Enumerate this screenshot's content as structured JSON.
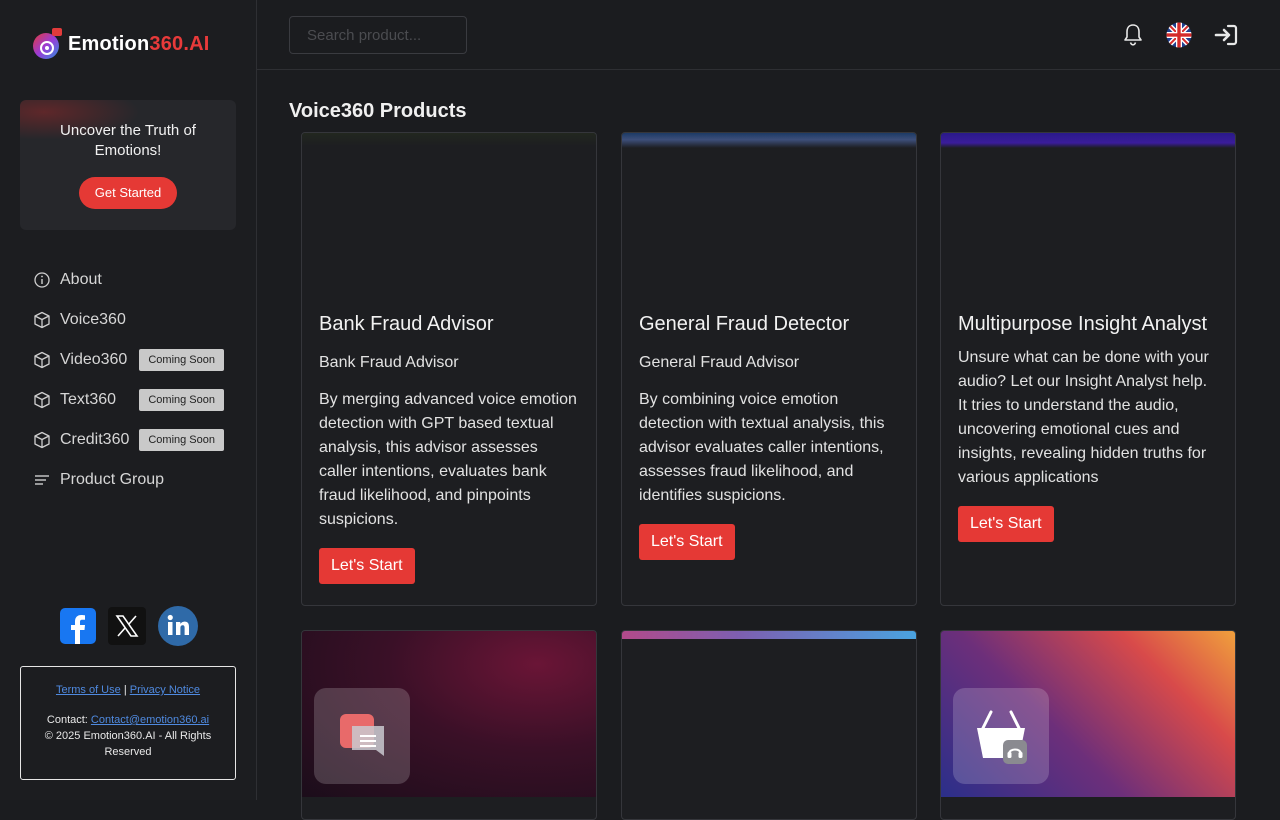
{
  "brand": {
    "name_white": "Emotion",
    "name_red": "360.AI"
  },
  "promo": {
    "text": "Uncover the Truth of Emotions!",
    "button": "Get Started"
  },
  "nav": {
    "items": [
      {
        "label": "About",
        "icon": "info-icon",
        "badge": ""
      },
      {
        "label": "Voice360",
        "icon": "cube-icon",
        "badge": ""
      },
      {
        "label": "Video360",
        "icon": "cube-icon",
        "badge": "Coming Soon"
      },
      {
        "label": "Text360",
        "icon": "cube-icon",
        "badge": "Coming Soon"
      },
      {
        "label": "Credit360",
        "icon": "cube-icon",
        "badge": "Coming Soon"
      },
      {
        "label": "Product Group",
        "icon": "list-icon",
        "badge": ""
      }
    ]
  },
  "social": [
    "facebook-icon",
    "x-icon",
    "linkedin-icon"
  ],
  "footer": {
    "terms": "Terms of Use",
    "separator": "|",
    "privacy": "Privacy Notice",
    "contact_label": "Contact:",
    "contact_email": "Contact@emotion360.ai",
    "copyright": "© 2025 Emotion360.AI - All Rights Reserved"
  },
  "search": {
    "placeholder": "Search product..."
  },
  "main": {
    "title": "Voice360 Products",
    "cards": [
      {
        "title": "Bank Fraud Advisor",
        "subtitle": "Bank Fraud Advisor",
        "description": "By merging advanced voice emotion detection with GPT based textual analysis, this advisor assesses caller intentions, evaluates bank fraud likelihood, and pinpoints suspicions.",
        "button": "Let's Start"
      },
      {
        "title": "General Fraud Detector",
        "subtitle": "General Fraud Advisor",
        "description": "By combining voice emotion detection with textual analysis, this advisor evaluates caller intentions, assesses fraud likelihood, and identifies suspicions.",
        "button": "Let's Start"
      },
      {
        "title": "Multipurpose Insight Analyst",
        "subtitle": "",
        "description": "Unsure what can be done with your audio? Let our Insight Analyst help. It tries to understand the audio, uncovering emotional cues and insights, revealing hidden truths for various applications",
        "button": "Let's Start"
      }
    ]
  },
  "colors": {
    "accent": "#e53935",
    "background": "#1b1c1f",
    "badge": "#c9c9c9"
  }
}
